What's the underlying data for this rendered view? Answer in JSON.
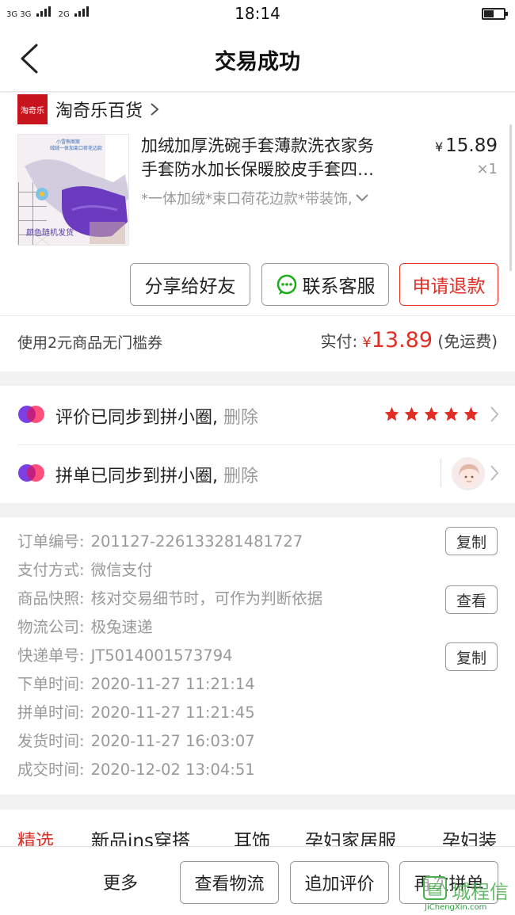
{
  "status_bar": {
    "network_1": "3G 3G",
    "network_2": "2G",
    "time": "18:14",
    "battery_level": 0.45
  },
  "header": {
    "title": "交易成功"
  },
  "store": {
    "logo_text": "淘奇乐",
    "name": "淘奇乐百货"
  },
  "product": {
    "title_line1": "加绒加厚洗碗手套薄款洗衣家务",
    "title_line2": "手套防水加长保暖胶皮手套四…",
    "spec": "*一体加绒*束口荷花边款*带装饰,",
    "currency": "¥",
    "price": "15.89",
    "quantity": "×1",
    "image_caption_top": "小雪熊图案",
    "image_caption_top2": "绒绒一体加束口荷花边款",
    "image_caption_bottom": "颜色随机发货"
  },
  "order_actions": {
    "share": "分享给好友",
    "customer_service": "联系客服",
    "refund": "申请退款"
  },
  "payment": {
    "coupon": "使用2元商品无门槛券",
    "paid_label": "实付:",
    "currency": "¥",
    "amount": "13.89",
    "shipping": "(免运费)"
  },
  "sync": {
    "review_text": "评价已同步到拼小圈,",
    "review_delete": "删除",
    "review_stars": 5,
    "group_text": "拼单已同步到拼小圈,",
    "group_delete": "删除"
  },
  "order_info": {
    "rows": [
      {
        "label": "订单编号:",
        "value": "201127-226133281481727"
      },
      {
        "label": "支付方式:",
        "value": "微信支付"
      },
      {
        "label": "商品快照:",
        "value": "核对交易细节时，可作为判断依据"
      },
      {
        "label": "物流公司:",
        "value": "极兔速递"
      },
      {
        "label": "快递单号:",
        "value": "JT5014001573794"
      },
      {
        "label": "下单时间:",
        "value": "2020-11-27 11:21:14"
      },
      {
        "label": "拼单时间:",
        "value": "2020-11-27 11:21:45"
      },
      {
        "label": "发货时间:",
        "value": "2020-11-27 16:03:07"
      },
      {
        "label": "成交时间:",
        "value": "2020-12-02 13:04:51"
      }
    ],
    "copy_label": "复制",
    "view_label": "查看"
  },
  "categories": [
    "精选",
    "新品ins穿搭",
    "耳饰",
    "孕妇家居服",
    "孕妇装"
  ],
  "bottom_bar": {
    "more": "更多",
    "logistics": "查看物流",
    "add_review": "追加评价",
    "reorder": "再次拼单"
  },
  "watermark": {
    "cn": "城程信",
    "en": "JiChengXin.com"
  },
  "colors": {
    "accent_red": "#e02e24",
    "brand_purple": "#7b3fe4"
  }
}
